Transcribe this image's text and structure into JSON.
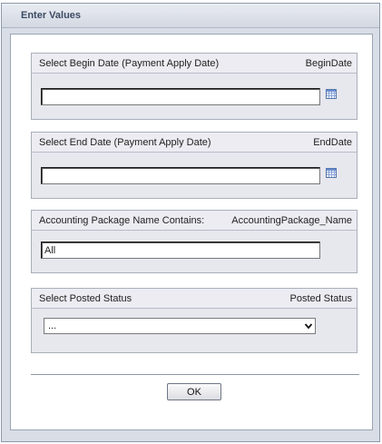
{
  "dialog": {
    "title": "Enter Values"
  },
  "params": {
    "begin": {
      "label": "Select Begin Date (Payment Apply Date)",
      "name": "BeginDate",
      "value": "",
      "icon": "calendar-icon"
    },
    "end": {
      "label": "Select End Date (Payment Apply Date)",
      "name": "EndDate",
      "value": "",
      "icon": "calendar-icon"
    },
    "package": {
      "label": "Accounting Package Name Contains:",
      "name": "AccountingPackage_Name",
      "value": "All"
    },
    "posted": {
      "label": "Select Posted Status",
      "name": "Posted Status",
      "selected": "...",
      "icon": "chevron-down-icon"
    }
  },
  "footer": {
    "ok_label": "OK"
  }
}
